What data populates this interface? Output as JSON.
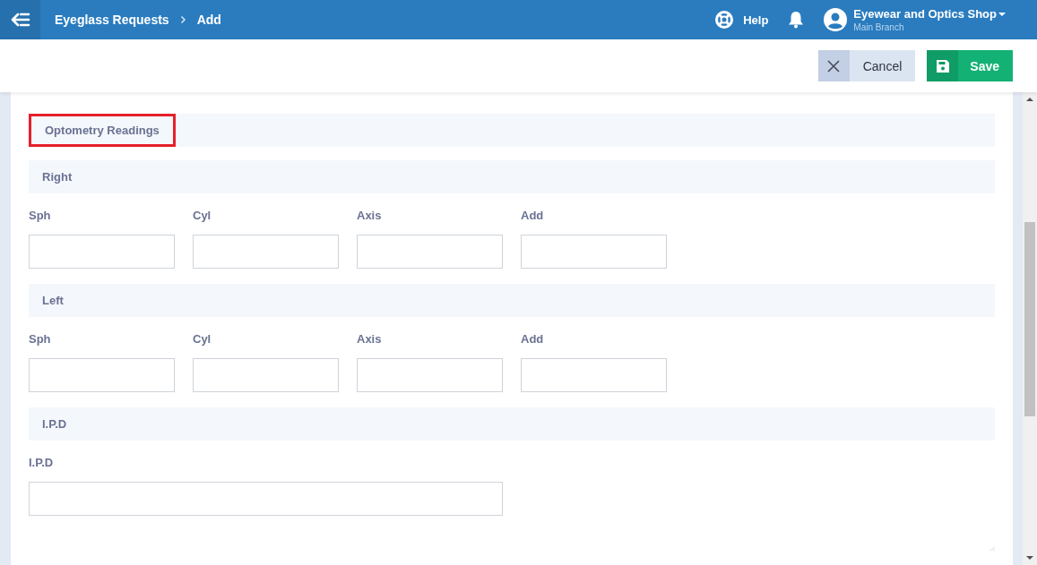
{
  "header": {
    "breadcrumb": [
      "Eyeglass Requests",
      "Add"
    ],
    "help": "Help",
    "account": {
      "name": "Eyewear and Optics Shop",
      "branch": "Main Branch"
    }
  },
  "toolbar": {
    "buttons": [
      {
        "kind": "cancel",
        "label": "Cancel"
      },
      {
        "kind": "save",
        "label": "Save"
      }
    ]
  },
  "form": {
    "title": {
      "text": "Optometry Readings",
      "highlighted": true
    },
    "groups": [
      {
        "heading": "Right",
        "kind": "grid",
        "fields": [
          {
            "label": "Sph"
          },
          {
            "label": "Cyl"
          },
          {
            "label": "Axis"
          },
          {
            "label": "Add"
          }
        ]
      },
      {
        "heading": "Left",
        "kind": "grid",
        "fields": [
          {
            "label": "Sph"
          },
          {
            "label": "Cyl"
          },
          {
            "label": "Axis"
          },
          {
            "label": "Add"
          }
        ]
      },
      {
        "heading": "I.P.D",
        "kind": "wide",
        "fields": [
          {
            "label": "I.P.D"
          }
        ]
      }
    ]
  }
}
